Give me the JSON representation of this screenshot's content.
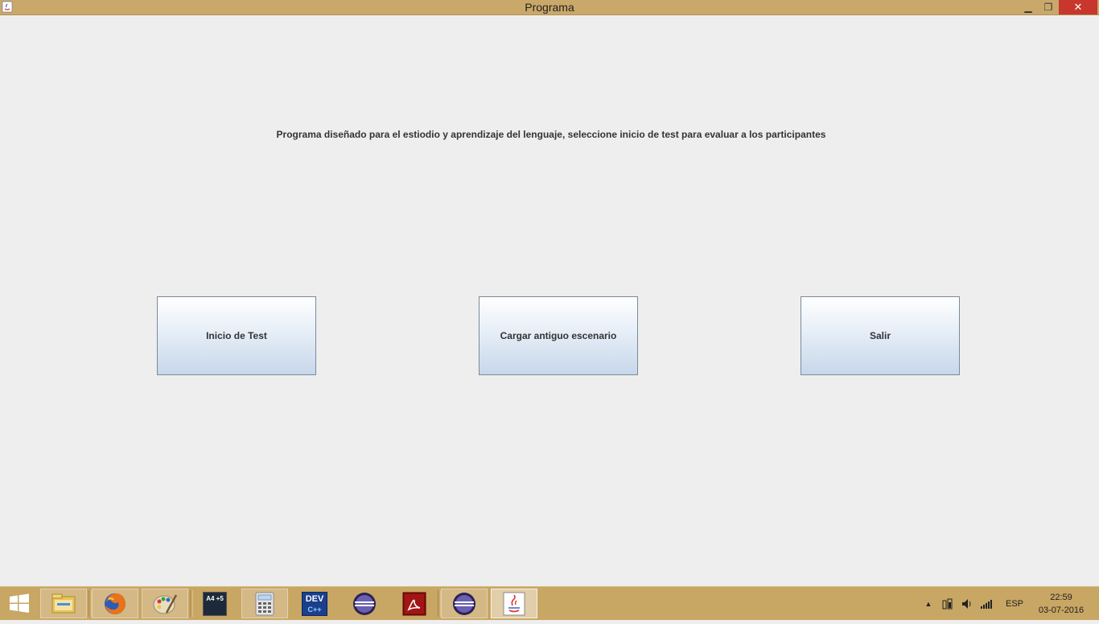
{
  "window": {
    "title": "Programa",
    "minimize_glyph": "▁",
    "maximize_glyph": "❐",
    "close_glyph": "✕"
  },
  "main": {
    "description": "Programa diseñado para el estiodio y aprendizaje del lenguaje,  seleccione inicio de test para evaluar a los participantes",
    "buttons": [
      {
        "label": "Inicio de Test"
      },
      {
        "label": "Cargar antiguo escenario"
      },
      {
        "label": "Salir"
      }
    ]
  },
  "taskbar": {
    "items": [
      {
        "icon": "file-explorer-icon"
      },
      {
        "icon": "firefox-icon"
      },
      {
        "icon": "paint-icon"
      },
      {
        "icon": "font-size-app-icon",
        "text": "A4 +5"
      },
      {
        "icon": "calculator-icon"
      },
      {
        "icon": "dev-cpp-icon",
        "text": "DEV"
      },
      {
        "icon": "eclipse-icon"
      },
      {
        "icon": "acrobat-icon"
      },
      {
        "icon": "eclipse-icon"
      },
      {
        "icon": "java-icon"
      }
    ],
    "language": "ESP",
    "time": "22:59",
    "date": "03-07-2016"
  },
  "colors": {
    "titlebar": "#c9a86a",
    "taskbar": "#c8a664",
    "close": "#c8372b",
    "window_bg": "#eeeeee"
  }
}
